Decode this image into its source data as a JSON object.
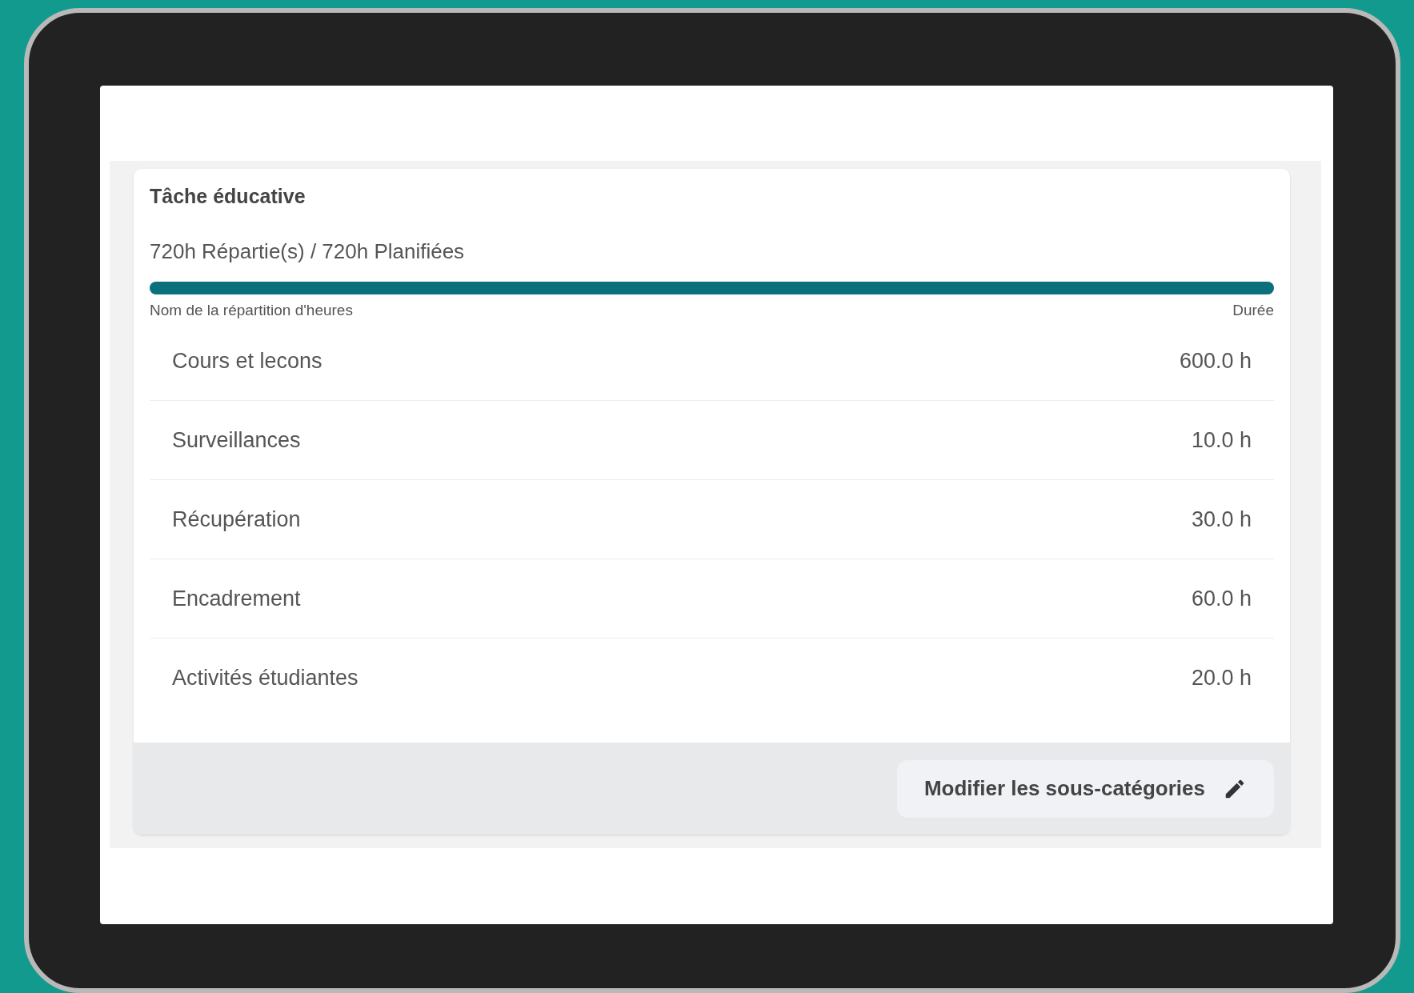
{
  "card": {
    "title": "Tâche éducative",
    "summary": "720h Répartie(s) / 720h Planifiées",
    "progress": {
      "level": 1.0
    },
    "columns": [
      "Nom de la répartition d'heures",
      "Durée"
    ],
    "rows": [
      {
        "name": "Cours et lecons",
        "duration": "600.0 h"
      },
      {
        "name": "Surveillances",
        "duration": "10.0 h"
      },
      {
        "name": "Récupération",
        "duration": "30.0 h"
      },
      {
        "name": "Encadrement",
        "duration": "60.0 h"
      },
      {
        "name": "Activités étudiantes",
        "duration": "20.0 h"
      }
    ],
    "edit_button": "Modifier les sous-catégories"
  }
}
